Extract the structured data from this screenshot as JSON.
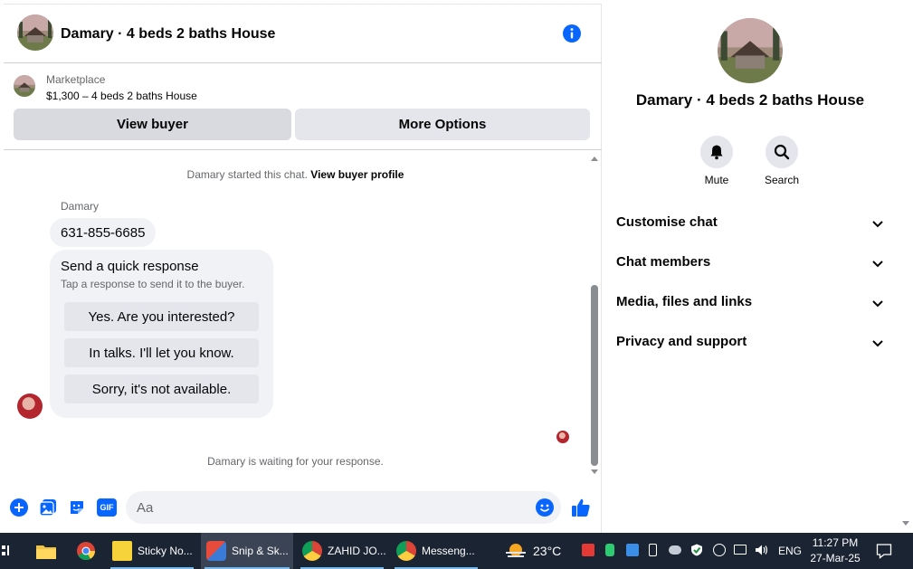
{
  "header": {
    "title": "Damary · 4 beds 2 baths House"
  },
  "marketplace": {
    "label": "Marketplace",
    "listing": "$1,300 – 4 beds 2 baths House",
    "buttons": {
      "view_buyer": "View buyer",
      "more_options": "More Options"
    }
  },
  "messages": {
    "started_prefix": "Damary started this chat.",
    "started_link": "View buyer profile",
    "sender_name": "Damary",
    "phone": "631-855-6685",
    "quick": {
      "title": "Send a quick response",
      "subtitle": "Tap a response to send it to the buyer.",
      "options": [
        "Yes. Are you interested?",
        "In talks. I'll let you know.",
        "Sorry, it's not available."
      ]
    },
    "waiting": "Damary is waiting for your response."
  },
  "composer": {
    "placeholder": "Aa",
    "gif_label": "GIF"
  },
  "sidebar": {
    "title": "Damary · 4 beds 2 baths House",
    "actions": {
      "mute": "Mute",
      "search": "Search"
    },
    "sections": [
      "Customise chat",
      "Chat members",
      "Media, files and links",
      "Privacy and support"
    ]
  },
  "taskbar": {
    "apps": [
      {
        "label": "Sticky No..."
      },
      {
        "label": "Snip & Sk..."
      },
      {
        "label": "ZAHID JO..."
      },
      {
        "label": "Messeng..."
      }
    ],
    "weather": "23°C",
    "language": "ENG",
    "time": "11:27 PM",
    "date": "27-Mar-25"
  },
  "colors": {
    "accent": "#0866ff",
    "taskbar": "#1b2433"
  }
}
